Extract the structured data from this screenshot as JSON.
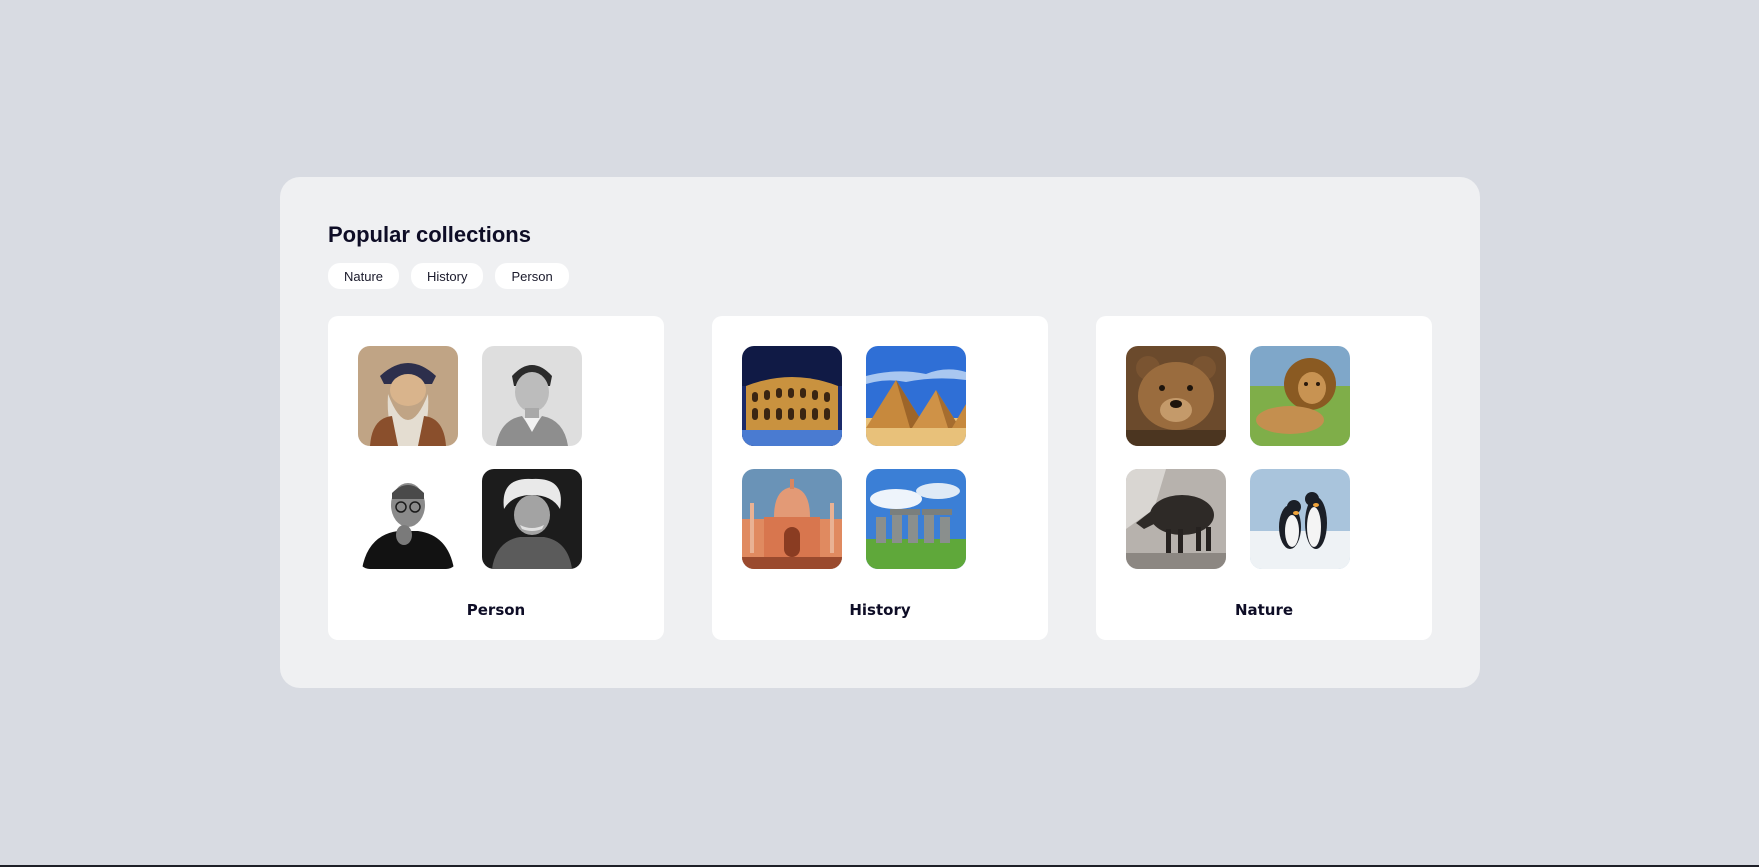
{
  "page": {
    "title": "Popular collections",
    "background": "#d8dbe2",
    "panel_background": "#eff0f2"
  },
  "filters": [
    {
      "label": "Nature"
    },
    {
      "label": "History"
    },
    {
      "label": "Person"
    }
  ],
  "collections": [
    {
      "label": "Person",
      "images": [
        {
          "icon": "portrait-bearded-man-image"
        },
        {
          "icon": "portrait-young-man-image"
        },
        {
          "icon": "portrait-man-glasses-image"
        },
        {
          "icon": "portrait-white-hair-man-image"
        }
      ]
    },
    {
      "label": "History",
      "images": [
        {
          "icon": "colosseum-image"
        },
        {
          "icon": "pyramids-image"
        },
        {
          "icon": "taj-mahal-image"
        },
        {
          "icon": "stonehenge-image"
        }
      ]
    },
    {
      "label": "Nature",
      "images": [
        {
          "icon": "bear-image"
        },
        {
          "icon": "lion-image"
        },
        {
          "icon": "boar-image"
        },
        {
          "icon": "penguins-image"
        }
      ]
    }
  ]
}
